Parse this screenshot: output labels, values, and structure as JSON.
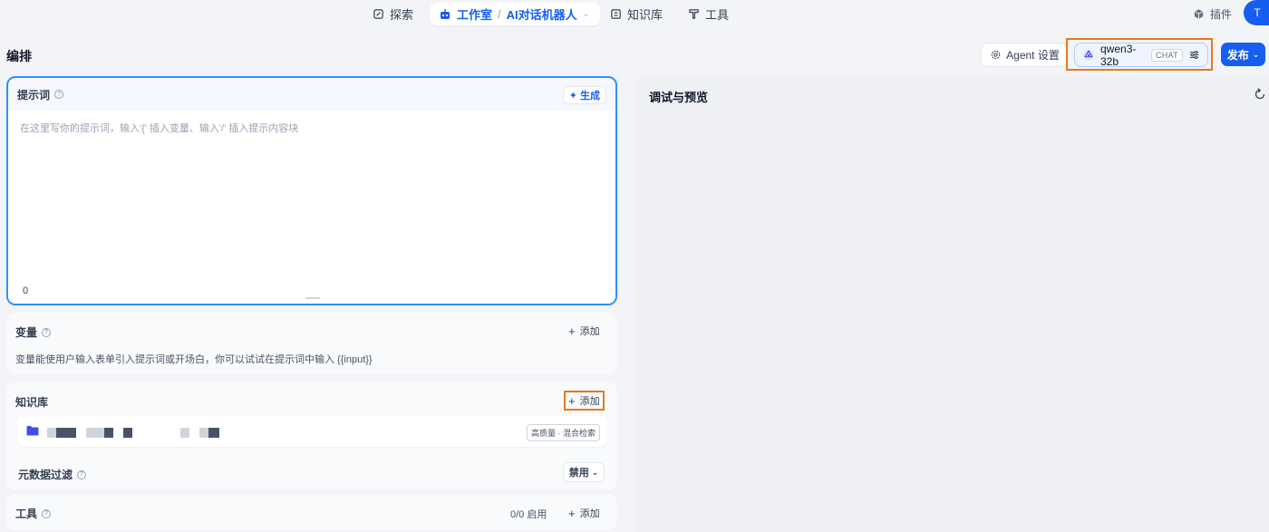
{
  "nav": {
    "explore": "探索",
    "studio": "工作室",
    "separator": "/",
    "app_name": "AI对话机器人",
    "knowledge": "知识库",
    "tools": "工具",
    "plugins": "插件",
    "avatar_initial": "T"
  },
  "header": {
    "title": "编排",
    "agent_settings": "Agent 设置",
    "model_name": "qwen3-32b",
    "model_mode": "CHAT",
    "publish": "发布"
  },
  "prompt": {
    "title": "提示词",
    "generate": "生成",
    "placeholder": "在这里写你的提示词，输入'{' 插入变量、输入'/' 插入提示内容块",
    "char_count": "0"
  },
  "variables": {
    "title": "变量",
    "add": "添加",
    "description": "变量能使用户输入表单引入提示词或开场白，你可以试试在提示词中输入 {{input}}"
  },
  "knowledge": {
    "title": "知识库",
    "add": "添加",
    "item_tag": "高质量 · 混合检索",
    "metadata_filter": "元数据过滤",
    "metadata_value": "禁用"
  },
  "tools": {
    "title": "工具",
    "count": "0/0 启用",
    "add": "添加"
  },
  "debug": {
    "title": "调试与预览"
  },
  "colors": {
    "accent": "#155eef",
    "highlight_box": "#e37b1c",
    "prompt_border": "#2e90fa"
  }
}
